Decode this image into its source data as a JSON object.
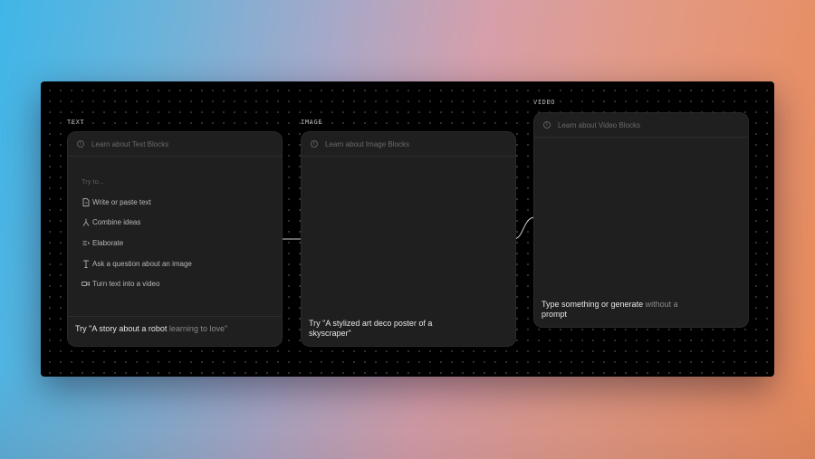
{
  "blocks": {
    "text": {
      "label": "TEXT",
      "header": "Learn about Text Blocks",
      "try_label": "Try to...",
      "suggestions": [
        {
          "label": "Write or paste text",
          "icon": "document-icon"
        },
        {
          "label": "Combine ideas",
          "icon": "merge-icon"
        },
        {
          "label": "Elaborate",
          "icon": "elaborate-icon"
        },
        {
          "label": "Ask a question about an image",
          "icon": "text-cursor-icon"
        },
        {
          "label": "Turn text into a video",
          "icon": "video-camera-icon"
        }
      ],
      "prompt": {
        "prefix": "Try \"A story about a robot ",
        "dim": "learning to love\""
      }
    },
    "image": {
      "label": "IMAGE",
      "header": "Learn about Image Blocks",
      "prompt": "Try \"A stylized art deco poster of a skyscraper\""
    },
    "video": {
      "label": "VIDEO",
      "header": "Learn about Video Blocks",
      "prompt": {
        "part1": "Type something or generate ",
        "dim": "without a",
        "part2": " prompt"
      }
    }
  },
  "colors": {
    "canvas": "#000000",
    "card": "#1f1f1f",
    "accent_text": "#e6e6e6"
  }
}
